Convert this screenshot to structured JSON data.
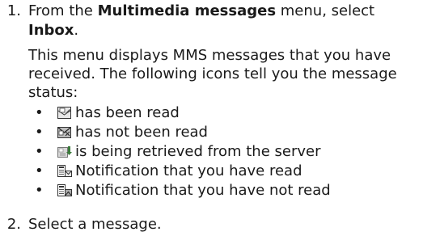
{
  "steps": [
    {
      "number": "1.",
      "line1_prefix": "From the ",
      "line1_bold": "Multimedia messages",
      "line1_suffix": " menu, select",
      "line2_bold": "Inbox",
      "line2_suffix": "."
    },
    {
      "number": "2.",
      "text": "Select a message."
    }
  ],
  "description": {
    "line1": "This menu displays MMS messages that you have",
    "line2": "received. The following icons tell you the message",
    "line3": "status:"
  },
  "bullet_char": "•",
  "status_items": [
    {
      "icon": "mms-read-icon",
      "text": "has been read"
    },
    {
      "icon": "mms-unread-icon",
      "text": "has not been read"
    },
    {
      "icon": "mms-retrieving-icon",
      "text": "is being retrieved from the server"
    },
    {
      "icon": "notification-read-icon",
      "text": "Notification that you have read"
    },
    {
      "icon": "notification-unread-icon",
      "text": "Notification that you have not read"
    }
  ]
}
